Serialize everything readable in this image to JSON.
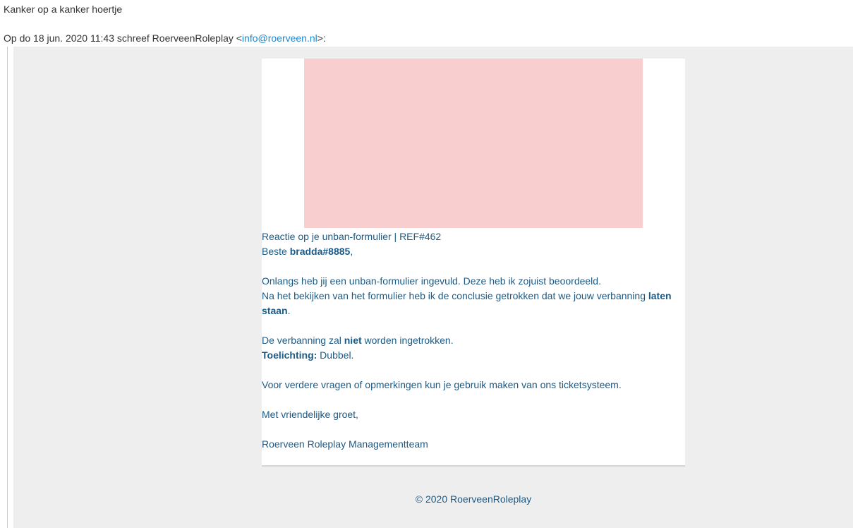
{
  "reply": {
    "text": "Kanker op a kanker hoertje"
  },
  "quote": {
    "prefix": "Op do 18 jun. 2020 11:43 schreef RoerveenRoleplay <",
    "email": "info@roerveen.nl",
    "suffix": ">:"
  },
  "email": {
    "subject": "Reactie op je unban-formulier | REF#462",
    "greeting_prefix": "Beste ",
    "username": "bradda#8885",
    "greeting_suffix": ",",
    "para1_line1": "Onlangs heb jij een unban-formulier ingevuld. Deze heb ik zojuist beoordeeld.",
    "para1_line2_prefix": "Na het bekijken van het formulier heb ik de conclusie getrokken dat we jouw verbanning ",
    "para1_line2_bold": "laten staan",
    "para1_line2_suffix": ".",
    "decision_prefix": "De verbanning zal ",
    "decision_bold": "niet",
    "decision_suffix": " worden ingetrokken.",
    "explanation_label": "Toelichting:",
    "explanation_value": " Dubbel.",
    "questions": "Voor verdere vragen of opmerkingen kun je gebruik maken van ons ticketsysteem.",
    "closing": "Met vriendelijke groet,",
    "signature": "Roerveen Roleplay Managementteam",
    "footer": "© 2020 RoerveenRoleplay"
  },
  "colors": {
    "link": "#1a8ad4",
    "email_text": "#1b5a85",
    "banner": "#f8cece",
    "quote_background": "#eeeeee"
  }
}
